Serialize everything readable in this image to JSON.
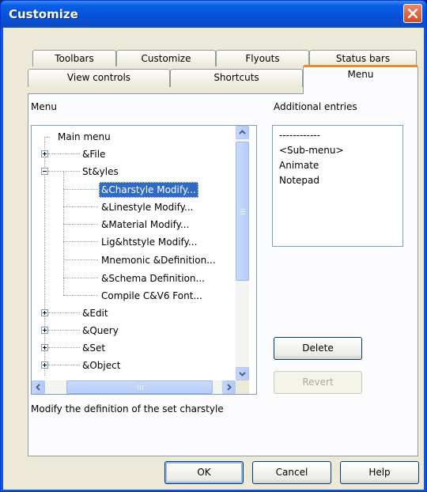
{
  "window": {
    "title": "Customize"
  },
  "tabs": {
    "row_back": [
      "Toolbars",
      "Customize",
      "Flyouts",
      "Status bars"
    ],
    "row_front": [
      "View controls",
      "Shortcuts",
      "Menu"
    ],
    "active": "Menu"
  },
  "menu_section": {
    "label": "Menu",
    "tree": {
      "root": "Main menu",
      "items": [
        {
          "label": "&File",
          "expander": "plus"
        },
        {
          "label": "St&yles",
          "expander": "minus"
        },
        {
          "label": "&Charstyle Modify...",
          "selected": true
        },
        {
          "label": "&Linestyle Modify..."
        },
        {
          "label": "&Material Modify..."
        },
        {
          "label": "Lig&htstyle Modify..."
        },
        {
          "label": "Mnemonic &Definition..."
        },
        {
          "label": "&Schema Definition..."
        },
        {
          "label": "Compile C&V6 Font..."
        },
        {
          "label": "&Edit",
          "expander": "plus"
        },
        {
          "label": "&Query",
          "expander": "plus"
        },
        {
          "label": "&Set",
          "expander": "plus"
        },
        {
          "label": "&Object",
          "expander": "plus"
        }
      ]
    },
    "description": "Modify the definition of the set charstyle"
  },
  "additional_section": {
    "label": "Additional entries",
    "items": [
      "------------",
      "<Sub-menu>",
      "Animate",
      "Notepad"
    ]
  },
  "buttons": {
    "delete": "Delete",
    "revert": "Revert",
    "ok": "OK",
    "cancel": "Cancel",
    "help": "Help"
  },
  "colors": {
    "titlebar": "#0a5ee6",
    "selection": "#316ac5",
    "active_tab_accent": "#e68b2c",
    "close_button": "#d24c22"
  }
}
